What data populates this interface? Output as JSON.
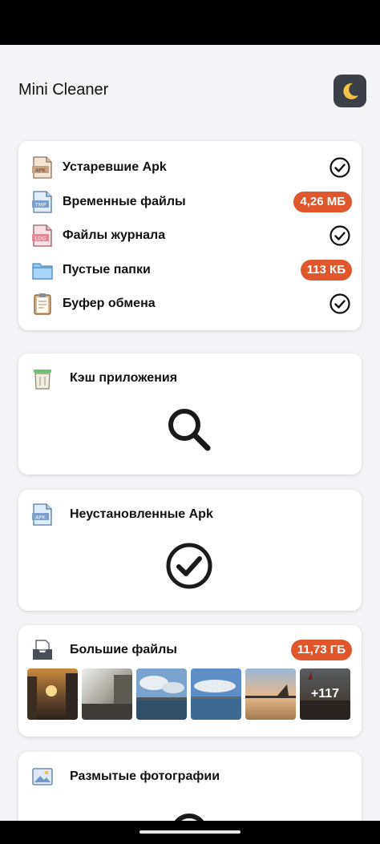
{
  "app": {
    "title": "Mini Cleaner",
    "theme_icon": "moon-icon"
  },
  "summary_items": [
    {
      "label": "Устаревшие Apk",
      "icon": "apk-file-icon",
      "status": "check",
      "value": ""
    },
    {
      "label": "Временные файлы",
      "icon": "tmp-file-icon",
      "status": "size",
      "value": "4,26 МБ"
    },
    {
      "label": "Файлы журнала",
      "icon": "log-file-icon",
      "status": "check",
      "value": ""
    },
    {
      "label": "Пустые папки",
      "icon": "folder-icon",
      "status": "size",
      "value": "113 КБ"
    },
    {
      "label": "Буфер обмена",
      "icon": "clipboard-icon",
      "status": "check",
      "value": ""
    }
  ],
  "cache_card": {
    "title": "Кэш приложения",
    "icon": "trash-can-icon",
    "state_icon": "search-icon"
  },
  "apk_card": {
    "title": "Неустановленные Apk",
    "icon": "apk-file-icon",
    "state_icon": "check-circle-icon"
  },
  "large_files_card": {
    "title": "Большие файлы",
    "icon": "inbox-tray-icon",
    "size": "11,73 ГБ",
    "more_count": "+117",
    "thumbnails": [
      "sunset-street-photo",
      "sunlit-street-photo",
      "river-sky-photo",
      "river-clouds-photo",
      "sunset-bridge-photo",
      "ship-at-dusk-photo"
    ]
  },
  "blurry_card": {
    "title": "Размытые фотографии",
    "icon": "photo-icon"
  },
  "colors": {
    "accent": "#e0562d",
    "background": "#f4f4f6",
    "theme_button": "#3b4048"
  }
}
